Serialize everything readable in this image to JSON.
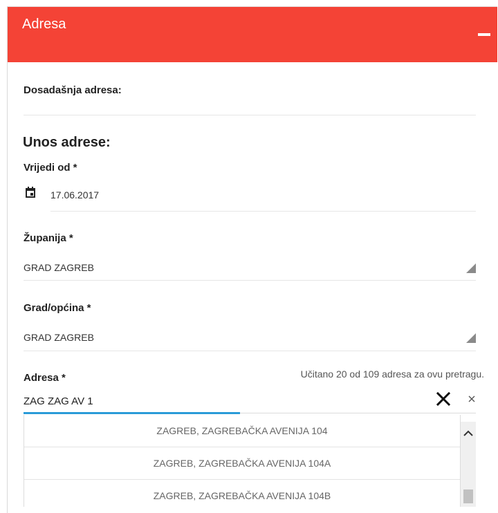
{
  "header": {
    "title": "Adresa"
  },
  "previous_address": {
    "label": "Dosadašnja adresa:"
  },
  "entry": {
    "title": "Unos adrese:",
    "valid_from": {
      "label": "Vrijedi od *",
      "value": "17.06.2017",
      "icon": "calendar-icon"
    },
    "county": {
      "label": "Županija *",
      "value": "GRAD ZAGREB"
    },
    "city": {
      "label": "Grad/općina *",
      "value": "GRAD ZAGREB"
    },
    "address": {
      "label": "Adresa *",
      "hint": "Učitano 20 od 109 adresa za ovu pretragu.",
      "value": "ZAG ZAG AV 1",
      "options": [
        "ZAGREB, ZAGREBAČKA AVENIJA 104",
        "ZAGREB, ZAGREBAČKA AVENIJA 104A",
        "ZAGREB, ZAGREBAČKA AVENIJA 104B"
      ]
    }
  },
  "colors": {
    "header": "#f44336",
    "focus": "#2a9bd8"
  }
}
